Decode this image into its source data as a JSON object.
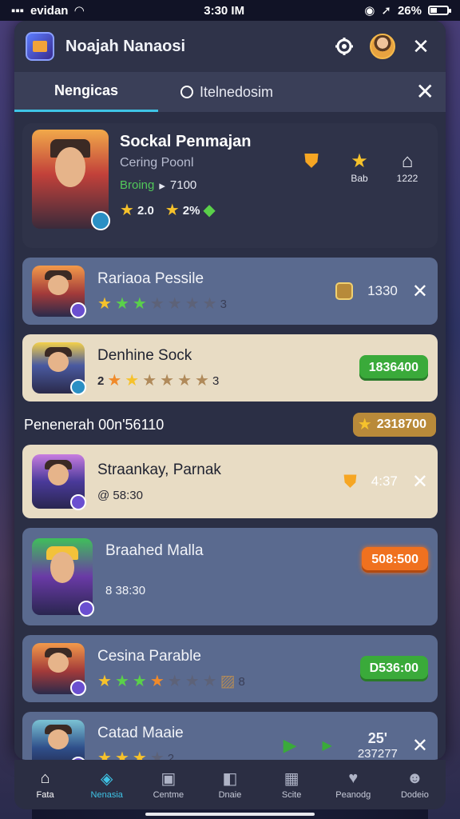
{
  "status_bar": {
    "carrier": "evidan",
    "time": "3:30 IM",
    "battery_text": "26%"
  },
  "header": {
    "title": "Noajah Nanaosi"
  },
  "tabs": [
    {
      "label": "Nengicas"
    },
    {
      "label": "Itelnedosim"
    }
  ],
  "featured": {
    "title": "Sockal Penmajan",
    "subtitle": "Cering Poonl",
    "status_label": "Broing",
    "status_value": "7100",
    "stat1": "2.0",
    "stat2": "2%",
    "side_col1": "Bab",
    "side_col2": "1222"
  },
  "rows_top": [
    {
      "name": "Rariaoa Pessile",
      "value": "1330",
      "stars_text": "3"
    },
    {
      "name": "Denhine Sock",
      "lead_num": "2",
      "stars_text": "3",
      "button": "1836400"
    }
  ],
  "section": {
    "label": "Penenerah 00n'56110",
    "value": "2318700"
  },
  "rows_bottom": [
    {
      "name": "Straankay, Parnak",
      "meta": "@ 58:30",
      "value": "4:37"
    },
    {
      "name": "Braahed Malla",
      "meta": "8 38:30",
      "button": "508:500"
    },
    {
      "name": "Cesina Parable",
      "stars_text": "8",
      "button": "D536:00"
    },
    {
      "name": "Catad Maaie",
      "stars_text": "2",
      "value_top": "25'",
      "value_bottom": "237277"
    }
  ],
  "bottom_nav": [
    {
      "label": "Fata",
      "icon": "home-icon"
    },
    {
      "label": "Nenasia",
      "icon": "games-icon"
    },
    {
      "label": "Centme",
      "icon": "calendar-icon"
    },
    {
      "label": "Dnaie",
      "icon": "box-icon"
    },
    {
      "label": "Scite",
      "icon": "grid-icon"
    },
    {
      "label": "Peanodg",
      "icon": "chat-icon"
    },
    {
      "label": "Dodeio",
      "icon": "profile-icon"
    }
  ],
  "colors": {
    "accent": "#3fc4e6",
    "green_button": "#3aaa3a",
    "orange_button": "#f0711f",
    "gold": "#f6c22b"
  }
}
